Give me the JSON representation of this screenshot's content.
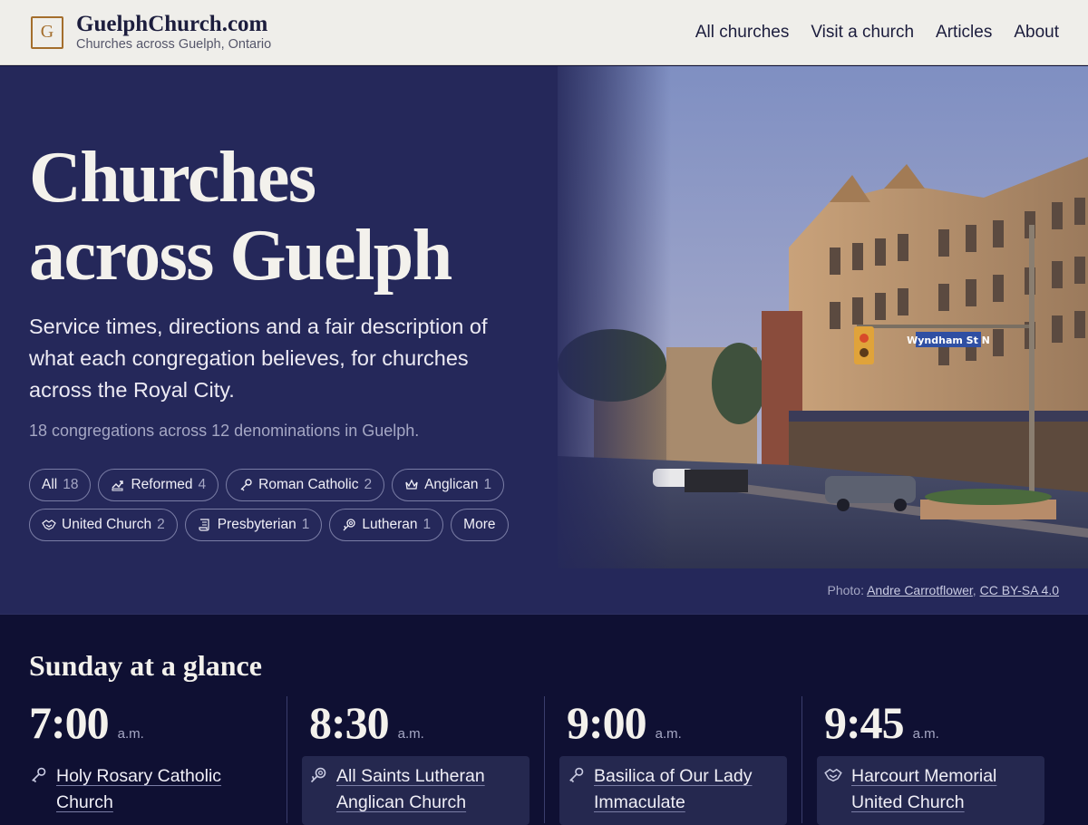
{
  "site": {
    "logo_letter": "G",
    "name": "GuelphChurch.com",
    "tagline": "Churches across Guelph, Ontario"
  },
  "nav": [
    {
      "label": "All churches"
    },
    {
      "label": "Visit a church"
    },
    {
      "label": "Articles"
    },
    {
      "label": "About"
    }
  ],
  "hero": {
    "title_line1": "Churches",
    "title_line2": "across Guelph",
    "lead": "Service times, directions and a fair description of what each congregation believes, for churches across the Royal City.",
    "count": "18 congregations across 12 denominations in Guelph.",
    "street_sign": "Wyndham St N",
    "chips": [
      {
        "label": "All",
        "count": "18",
        "icon": "none"
      },
      {
        "label": "Reformed",
        "count": "4",
        "icon": "reformed-icon"
      },
      {
        "label": "Roman Catholic",
        "count": "2",
        "icon": "key-icon"
      },
      {
        "label": "Anglican",
        "count": "1",
        "icon": "crown-icon"
      },
      {
        "label": "United Church",
        "count": "2",
        "icon": "handshake-icon"
      },
      {
        "label": "Presbyterian",
        "count": "1",
        "icon": "scroll-icon"
      },
      {
        "label": "Lutheran",
        "count": "1",
        "icon": "rose-icon"
      },
      {
        "label": "More",
        "count": "",
        "icon": "none"
      }
    ],
    "credit": {
      "prefix": "Photo: ",
      "author": "Andre Carrotflower",
      "separator": ", ",
      "license": "CC BY-SA 4.0"
    }
  },
  "sunday": {
    "title": "Sunday at a glance",
    "slots": [
      {
        "time": "7:00",
        "ampm": "a.m.",
        "church_line1": "Holy Rosary Catholic",
        "church_line2": "Church",
        "icon": "key-icon"
      },
      {
        "time": "8:30",
        "ampm": "a.m.",
        "church_line1": "All Saints Lutheran",
        "church_line2": "Anglican Church",
        "icon": "rose-icon"
      },
      {
        "time": "9:00",
        "ampm": "a.m.",
        "church_line1": "Basilica of Our Lady",
        "church_line2": "Immaculate",
        "icon": "key-icon"
      },
      {
        "time": "9:45",
        "ampm": "a.m.",
        "church_line1": "Harcourt Memorial",
        "church_line2": "United Church",
        "icon": "handshake-icon"
      }
    ]
  },
  "colors": {
    "header_bg": "#efeeea",
    "hero_bg": "#25285a",
    "sunday_bg": "#0f1033",
    "accent": "#a46e2c"
  }
}
